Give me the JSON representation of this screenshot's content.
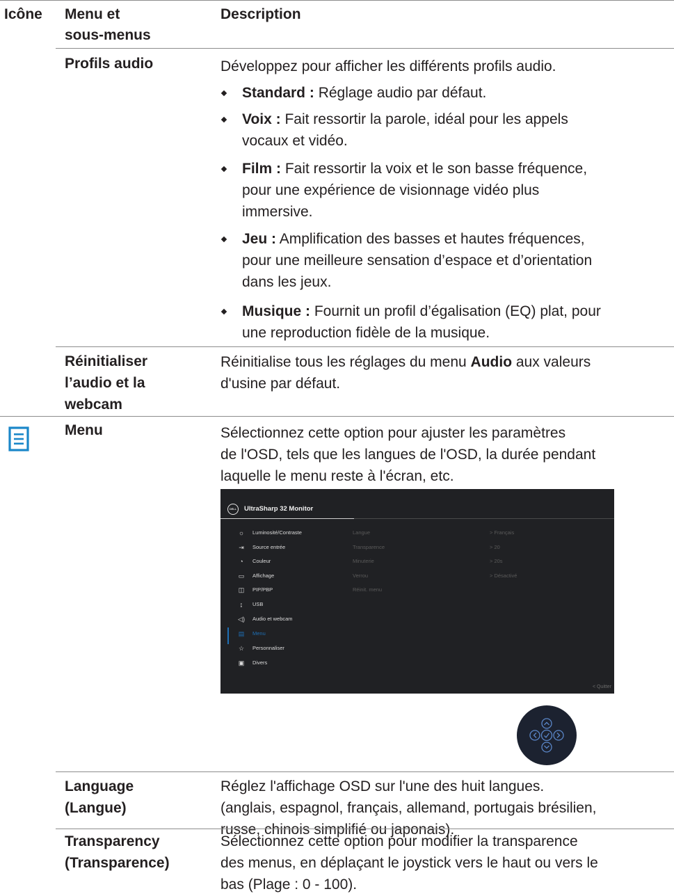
{
  "headers": {
    "icon": "Icône",
    "menu_line1": "Menu et",
    "menu_line2": "sous-menus",
    "description": "Description"
  },
  "audio_profiles": {
    "name": "Profils audio",
    "intro": "Développez pour afficher les différents profils audio.",
    "bullets": [
      {
        "term": "Standard :",
        "lines": [
          "Réglage audio par défaut."
        ]
      },
      {
        "term": "Voix :",
        "lines": [
          "Fait ressortir la parole, idéal pour les appels",
          "vocaux et vidéo."
        ]
      },
      {
        "term": "Film :",
        "lines": [
          "Fait ressortir la voix et le son basse fréquence,",
          "pour une expérience de visionnage vidéo plus",
          "immersive."
        ]
      },
      {
        "term": "Jeu :",
        "lines": [
          "Amplification des basses et hautes fréquences,",
          "pour une meilleure sensation d’espace et d’orientation",
          "dans les jeux."
        ]
      },
      {
        "term": "Musique :",
        "lines": [
          "Fournit un profil d’égalisation (EQ) plat, pour",
          "une reproduction fidèle de la musique."
        ]
      }
    ]
  },
  "reset": {
    "name_lines": [
      "Réinitialiser",
      "l’audio et la",
      "webcam"
    ],
    "desc_before": "Réinitialise tous les réglages du menu ",
    "desc_bold": "Audio",
    "desc_after": " aux valeurs",
    "desc_line2": "d'usine par défaut."
  },
  "menu": {
    "icon": "menu-list-icon",
    "name": "Menu",
    "desc_lines": [
      "Sélectionnez cette option pour ajuster les paramètres",
      "de l'OSD, tels que les langues de l'OSD, la durée pendant",
      "laquelle le menu reste à l'écran, etc."
    ]
  },
  "osd": {
    "logo": "DELL",
    "title": "UltraSharp 32 Monitor",
    "items": [
      {
        "icon": "brightness-icon",
        "glyph": "☼",
        "label": "Luminosité/Contraste"
      },
      {
        "icon": "input-source-icon",
        "glyph": "⇥",
        "label": "Source entrée"
      },
      {
        "icon": "color-palette-icon",
        "glyph": "◔",
        "label": "Couleur"
      },
      {
        "icon": "display-icon",
        "glyph": "▭",
        "label": "Affichage"
      },
      {
        "icon": "pip-pbp-icon",
        "glyph": "◫",
        "label": "PIP/PBP"
      },
      {
        "icon": "usb-icon",
        "glyph": "↨",
        "label": "USB"
      },
      {
        "icon": "audio-icon",
        "glyph": "◁)",
        "label": "Audio et webcam"
      },
      {
        "icon": "menu-icon",
        "glyph": "▤",
        "label": "Menu",
        "selected": true
      },
      {
        "icon": "star-icon",
        "glyph": "☆",
        "label": "Personnaliser"
      },
      {
        "icon": "others-icon",
        "glyph": "▣",
        "label": "Divers"
      }
    ],
    "options": [
      "Langue",
      "Transparence",
      "Minuterie",
      "Verrou",
      "Réinit. menu"
    ],
    "values": [
      "> Français",
      "> 20",
      "> 20s",
      "> Désactivé"
    ],
    "quit": "< Quitter",
    "accent_color": "#1e6fb5"
  },
  "language": {
    "name_lines": [
      "Language",
      "(Langue)"
    ],
    "desc_lines": [
      "Réglez l'affichage OSD sur l'une des huit langues.",
      "(anglais, espagnol, français, allemand, portugais brésilien,",
      "russe, chinois simplifié ou japonais)."
    ]
  },
  "transparency": {
    "name_lines": [
      "Transparency",
      "(Transparence)"
    ],
    "desc_lines": [
      "Sélectionnez cette option pour modifier la transparence",
      "des menus, en déplaçant le joystick vers le haut ou vers le",
      "bas (Plage : 0 - 100)."
    ]
  }
}
